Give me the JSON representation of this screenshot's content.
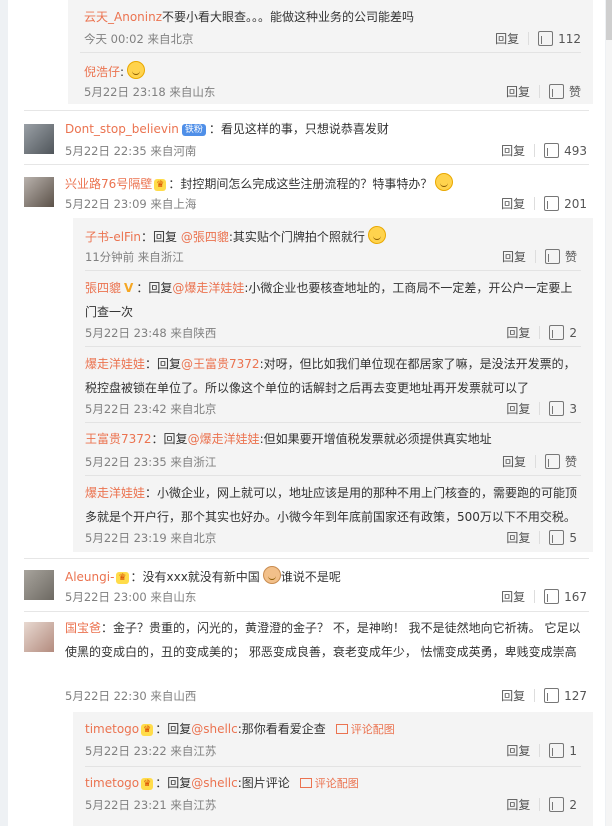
{
  "comments": [
    {
      "replies": [
        {
          "name": "云天_Anoninz",
          "text": "不要小看大眼查。。。能做这种业务的公司能差吗",
          "meta": "今天 00:02 来自北京",
          "reply": "回复",
          "like": "112"
        },
        {
          "name": "倪浩仔",
          "text": ":",
          "meta": "5月22日 23:18 来自山东",
          "reply": "回复",
          "like": "赞"
        }
      ]
    },
    {
      "name": "Dont_stop_believin",
      "badge": "铁粉",
      "text": "：看见这样的事，只想说恭喜发财",
      "meta": "5月22日 22:35 来自河南",
      "reply": "回复",
      "like": "493"
    },
    {
      "name": "兴业路76号隔壁",
      "text": "：封控期间怎么完成这些注册流程的？特事特办？",
      "meta": "5月22日 23:09 来自上海",
      "reply": "回复",
      "like": "201",
      "replies": [
        {
          "name": "子书-elFin",
          "pre": "：回复 ",
          "mention": "@張四貔",
          "text": ":其实贴个门牌拍个照就行",
          "meta": "11分钟前 来自浙江",
          "reply": "回复",
          "like": "赞"
        },
        {
          "name": "張四貔",
          "v": "V",
          "pre": "：回复",
          "mention": "@爆走洋娃娃",
          "text": ":小微企业也要核查地址的，工商局不一定差，开公户一定要上门查一次",
          "meta": "5月22日 23:48 来自陕西",
          "reply": "回复",
          "like": "2"
        },
        {
          "name": "爆走洋娃娃",
          "pre": "：回复",
          "mention": "@王富贵7372",
          "text": ":对呀，但比如我们单位现在都居家了嘛，是没法开发票的，税控盘被锁在单位了。所以像这个单位的话解封之后再去变更地址再开发票就可以了",
          "meta": "5月22日 23:42 来自北京",
          "reply": "回复",
          "like": "3"
        },
        {
          "name": "王富贵7372",
          "pre": "：回复",
          "mention": "@爆走洋娃娃",
          "text": ":但如果要开增值税发票就必须提供真实地址",
          "meta": "5月22日 23:35 来自浙江",
          "reply": "回复",
          "like": "赞"
        },
        {
          "name": "爆走洋娃娃",
          "text": "：小微企业，网上就可以，地址应该是用的那种不用上门核查的，需要跑的可能顶多就是个开户行，那个其实也好办。小微今年到年底前国家还有政策，500万以下不用交税。",
          "meta": "5月22日 23:19 来自北京",
          "reply": "回复",
          "like": "5"
        }
      ]
    },
    {
      "name": "Aleungi-",
      "text": "：没有xxx就没有新中国",
      "text2": "谁说不是呢",
      "meta": "5月22日 23:00 来自山东",
      "reply": "回复",
      "like": "167"
    },
    {
      "name": "国宝爸",
      "text": "：金子？贵重的，闪光的，黄澄澄的金子？        不，是神哟！        我不是徒然地向它祈祷。        它足以使黑的变成白的，丑的变成美的；        邪恶变成良善，衰老变成年少，        怯懦变成英勇，卑贱变成崇高",
      "meta": "5月22日 22:30 来自山西",
      "reply": "回复",
      "like": "127",
      "replies": [
        {
          "name": "timetogo",
          "pre": "：回复",
          "mention": "@shellc",
          "text": ":那你看看爱企查",
          "img": "评论配图",
          "meta": "5月22日 23:22 来自江苏",
          "reply": "回复",
          "like": "1"
        },
        {
          "name": "timetogo",
          "pre": "：回复",
          "mention": "@shellc",
          "text": ":图片评论",
          "img": "评论配图",
          "meta": "5月22日 23:21 来自江苏",
          "reply": "回复",
          "like": "2"
        }
      ]
    }
  ],
  "colors": {
    "accent": "#eb7350",
    "text": "#333333",
    "meta": "#808080",
    "background": "#ffffff"
  }
}
